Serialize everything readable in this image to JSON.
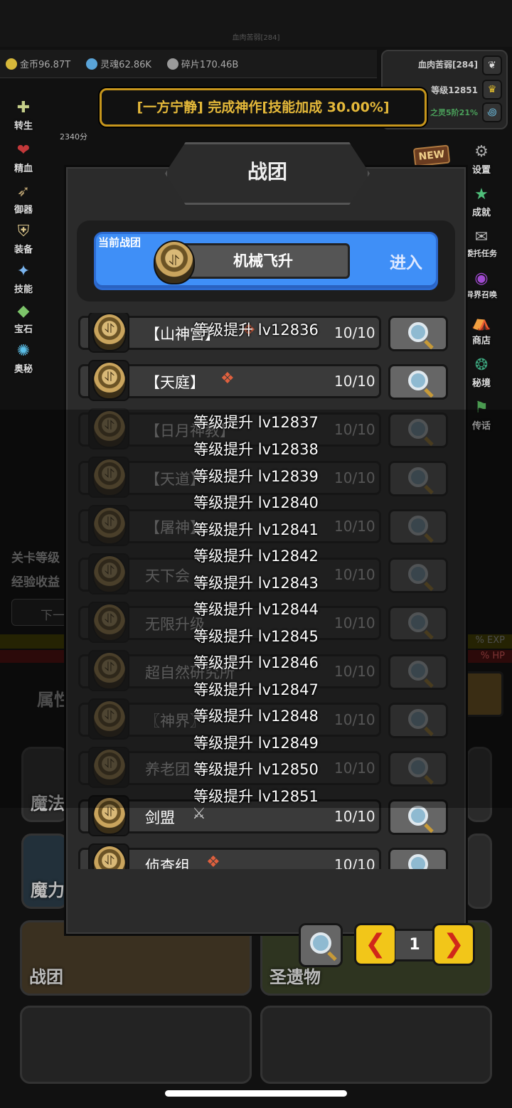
{
  "top": {
    "player_line": "血肉苦弱[284]"
  },
  "resources": [
    {
      "label": "金币96.87T",
      "icon": "coin-icon",
      "color": "#d6b83a"
    },
    {
      "label": "灵魂62.86K",
      "icon": "soul-icon",
      "color": "#5aa4d8"
    },
    {
      "label": "碎片170.46B",
      "icon": "fragment-icon",
      "color": "#9a9a9a"
    }
  ],
  "player_panel": {
    "name": "血肉苦弱[284]",
    "level": "等级12851",
    "sub": "之灵5阶21%"
  },
  "banner": {
    "text": "[一方宁静] 完成神作[技能加成 30.00%]"
  },
  "score": "2340分",
  "left_menu": [
    "转生",
    "精血",
    "御器",
    "装备",
    "技能",
    "宝石",
    "奥秘"
  ],
  "right_menu": [
    "设置",
    "成就",
    "委托任务",
    "异界召唤",
    "商店",
    "秘境",
    "传话"
  ],
  "new_badge": "NEW",
  "background": {
    "stage_label": "关卡等级",
    "exp_label": "经验收益",
    "next_btn": "下一",
    "exp_text": "% EXP",
    "hp_text": "% HP",
    "attr_text": "属性",
    "cards": [
      "魔法",
      "魔力",
      "战团",
      "圣遗物"
    ]
  },
  "dialog": {
    "title": "战团",
    "current_label": "当前战团",
    "current_name": "机械飞升",
    "enter_label": "进入",
    "rows": [
      {
        "name": "【山神宫】",
        "count": "10/10"
      },
      {
        "name": "【天庭】",
        "count": "10/10"
      },
      {
        "name": "【日月神教】",
        "count": "10/10"
      },
      {
        "name": "【天道】",
        "count": "10/10"
      },
      {
        "name": "【屠神】",
        "count": "10/10"
      },
      {
        "name": "天下会",
        "count": "10/10"
      },
      {
        "name": "无限升级",
        "count": "10/10"
      },
      {
        "name": "超自然研究所",
        "count": "10/10"
      },
      {
        "name": "〖神界〗",
        "count": "10/10"
      },
      {
        "name": "养老团",
        "count": "10/10"
      },
      {
        "name": "剑盟",
        "count": "10/10"
      },
      {
        "name": "侦查组",
        "count": "10/10"
      }
    ],
    "page": "1"
  },
  "levelups": [
    "等级提升 lv12836",
    "等级提升 lv12837",
    "等级提升 lv12838",
    "等级提升 lv12839",
    "等级提升 lv12840",
    "等级提升 lv12841",
    "等级提升 lv12842",
    "等级提升 lv12843",
    "等级提升 lv12844",
    "等级提升 lv12845",
    "等级提升 lv12846",
    "等级提升 lv12847",
    "等级提升 lv12848",
    "等级提升 lv12849",
    "等级提升 lv12850",
    "等级提升 lv12851"
  ]
}
